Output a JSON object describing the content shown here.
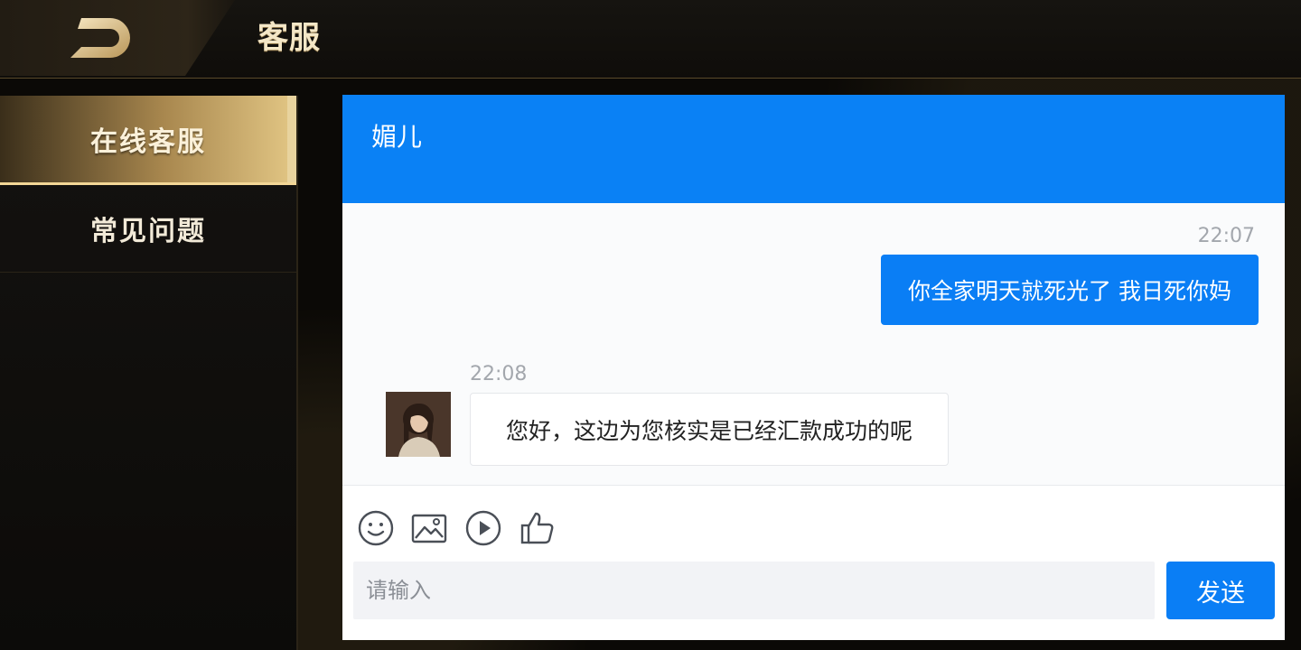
{
  "header": {
    "title": "客服"
  },
  "sidebar": {
    "items": [
      {
        "label": "在线客服",
        "active": true
      },
      {
        "label": "常见问题",
        "active": false
      }
    ]
  },
  "chat": {
    "agent_name": "媚儿",
    "messages": [
      {
        "direction": "outgoing",
        "time": "22:07",
        "text": "你全家明天就死光了 我日死你妈"
      },
      {
        "direction": "incoming",
        "time": "22:08",
        "text": "您好，这边为您核实是已经汇款成功的呢"
      }
    ],
    "toolbar": [
      "emoji-icon",
      "image-icon",
      "video-icon",
      "thumbs-up-icon"
    ],
    "input_placeholder": "请输入",
    "send_label": "发送"
  },
  "colors": {
    "accent": "#0a7ef5",
    "gold": "#e3c785"
  }
}
